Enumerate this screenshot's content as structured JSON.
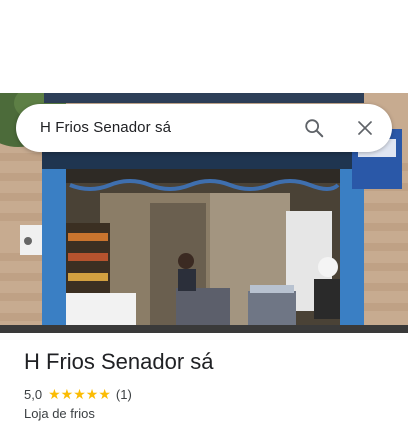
{
  "search": {
    "query": "H Frios Senador sá",
    "search_icon": "search-icon",
    "close_icon": "close-icon"
  },
  "place": {
    "photo_icon": "storefront-photo",
    "name": "H Frios Senador sá",
    "rating": "5,0",
    "stars": 5,
    "review_count": "(1)",
    "category": "Loja de frios"
  },
  "colors": {
    "star": "#fbbc04",
    "text_primary": "#202124",
    "text_secondary": "#3c4043",
    "storefront_blue": "#3a7fc4"
  }
}
